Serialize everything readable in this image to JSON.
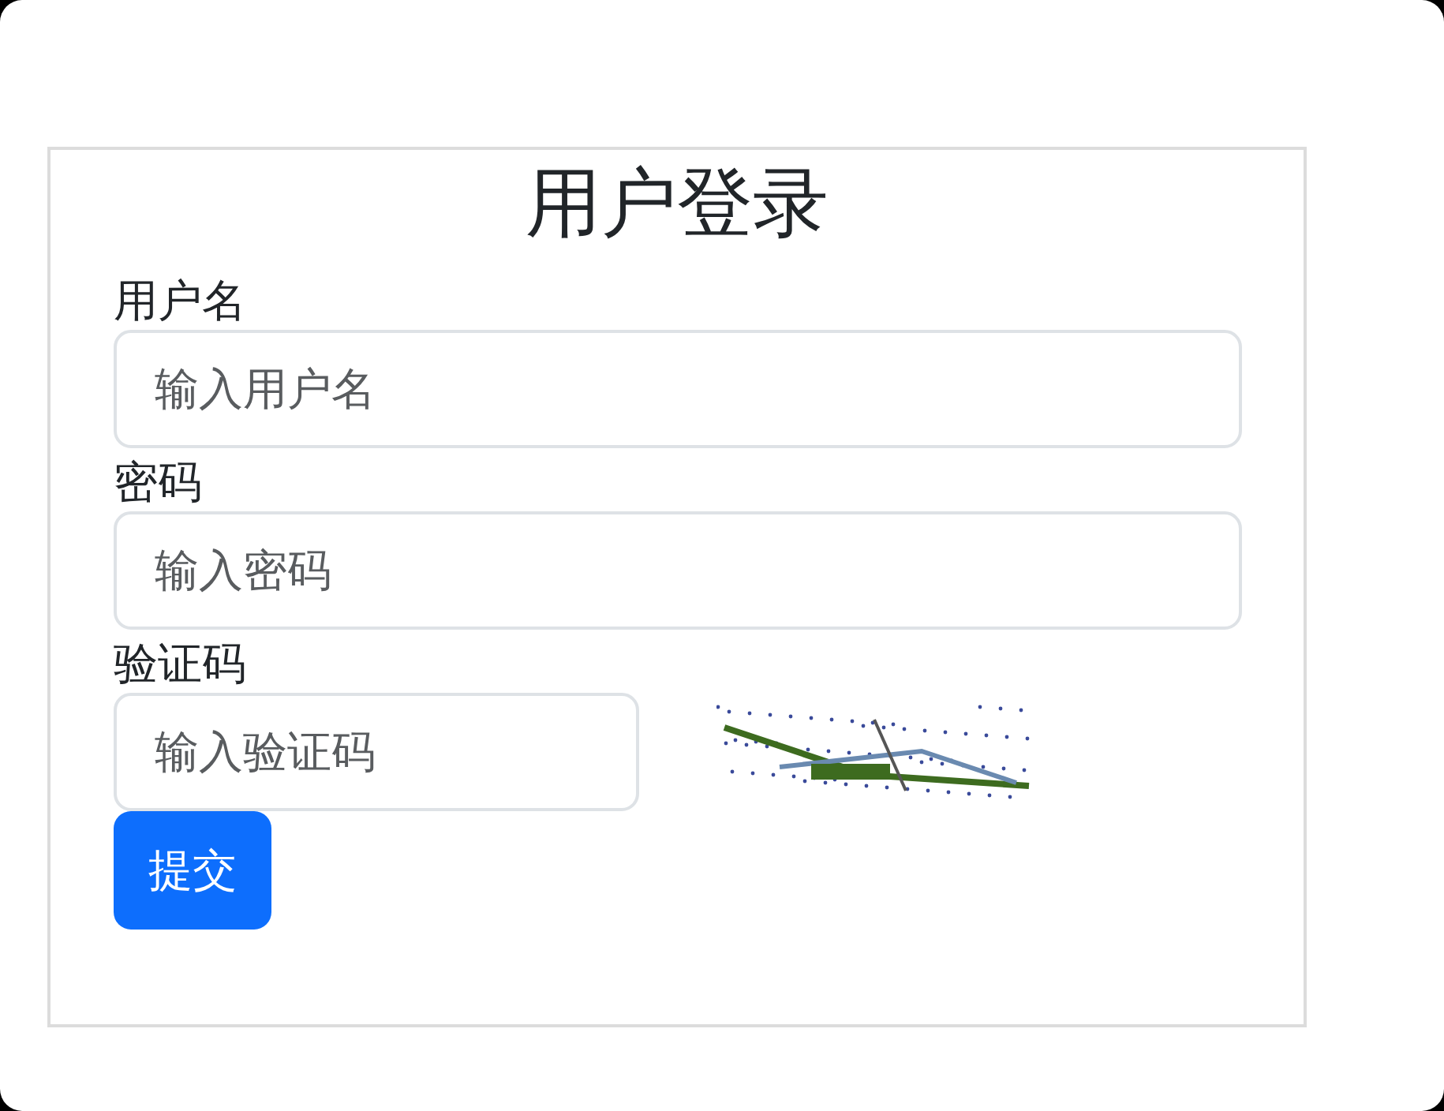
{
  "title": "用户登录",
  "fields": [
    {
      "kind": "text",
      "label": "用户名",
      "placeholder": "输入用户名"
    },
    {
      "kind": "text",
      "label": "密码",
      "placeholder": "输入密码"
    },
    {
      "kind": "captcha",
      "label": "验证码",
      "placeholder": "输入验证码"
    }
  ],
  "submit": "提交"
}
